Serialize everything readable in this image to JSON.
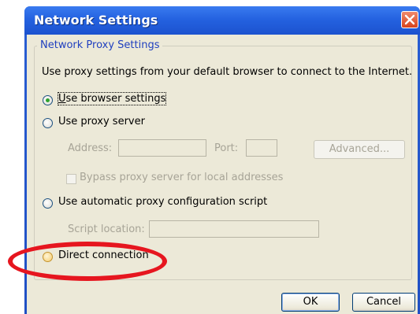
{
  "window": {
    "title": "Network Settings",
    "title_bar_color": "#2462e0",
    "close_icon": "close-x-icon"
  },
  "group": {
    "label": "Network Proxy Settings",
    "description": "Use proxy settings from your default browser to connect to the Internet."
  },
  "options": {
    "browser": {
      "label": "Use browser settings",
      "selected": true
    },
    "proxy_server": {
      "label": "Use proxy server",
      "selected": false
    },
    "auto_script": {
      "label": "Use automatic proxy configuration script",
      "selected": false
    },
    "direct": {
      "label": "Direct connection",
      "selected": false,
      "highlighted": true
    }
  },
  "proxy": {
    "address_label": "Address:",
    "address_value": "",
    "port_label": "Port:",
    "port_value": "",
    "advanced_label": "Advanced...",
    "bypass_label": "Bypass proxy server for local addresses",
    "bypass_checked": false
  },
  "script": {
    "location_label": "Script location:",
    "location_value": ""
  },
  "buttons": {
    "ok": "OK",
    "cancel": "Cancel"
  },
  "annotation": {
    "color": "#e6161f",
    "shape": "ellipse-around-direct-connection"
  }
}
